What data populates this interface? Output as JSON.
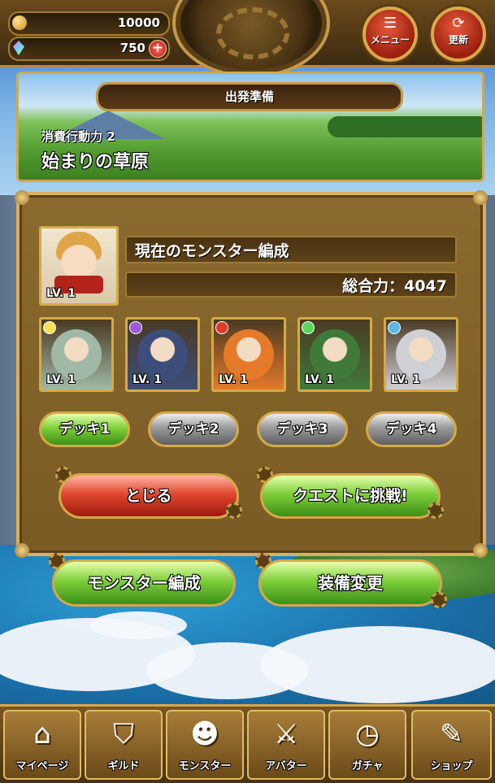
{
  "resources": {
    "gold": "10000",
    "gems": "750",
    "add_icon": "plus-icon"
  },
  "header": {
    "menu_label": "メニュー",
    "refresh_label": "更新"
  },
  "quest": {
    "screen_title": "出発準備",
    "cost_label": "消費行動力 2",
    "name": "始まりの草原"
  },
  "formation": {
    "title": "現在のモンスター編成",
    "total_power": "総合力：4047",
    "leader": {
      "level": "LV. 1"
    },
    "members": [
      {
        "level": "LV. 1",
        "element_color": "#f5e15a",
        "art_color": "#9fb9a6"
      },
      {
        "level": "LV. 1",
        "element_color": "#9b5ad9",
        "art_color": "#3d4e7a"
      },
      {
        "level": "LV. 1",
        "element_color": "#e2382a",
        "art_color": "#e47a2a"
      },
      {
        "level": "LV. 1",
        "element_color": "#5ad95a",
        "art_color": "#3f7a3a"
      },
      {
        "level": "LV. 1",
        "element_color": "#5ab9e6",
        "art_color": "#cfcfd6"
      }
    ]
  },
  "decks": [
    {
      "label": "デッキ1",
      "selected": true
    },
    {
      "label": "デッキ2",
      "selected": false
    },
    {
      "label": "デッキ3",
      "selected": false
    },
    {
      "label": "デッキ4",
      "selected": false
    }
  ],
  "actions": {
    "close_label": "とじる",
    "start_label": "クエストに挑戦!"
  },
  "bottom_actions": {
    "formation_label": "モンスター編成",
    "equipment_label": "装備変更"
  },
  "tabs": [
    {
      "label": "マイページ",
      "icon": "home-icon",
      "glyph": "⌂"
    },
    {
      "label": "ギルド",
      "icon": "shield-icon",
      "glyph": "⛉"
    },
    {
      "label": "モンスター",
      "icon": "monster-icon",
      "glyph": "☻"
    },
    {
      "label": "アバター",
      "icon": "sword-icon",
      "glyph": "⚔"
    },
    {
      "label": "ガチャ",
      "icon": "clock-icon",
      "glyph": "◷"
    },
    {
      "label": "ショップ",
      "icon": "feather-icon",
      "glyph": "✎"
    }
  ]
}
